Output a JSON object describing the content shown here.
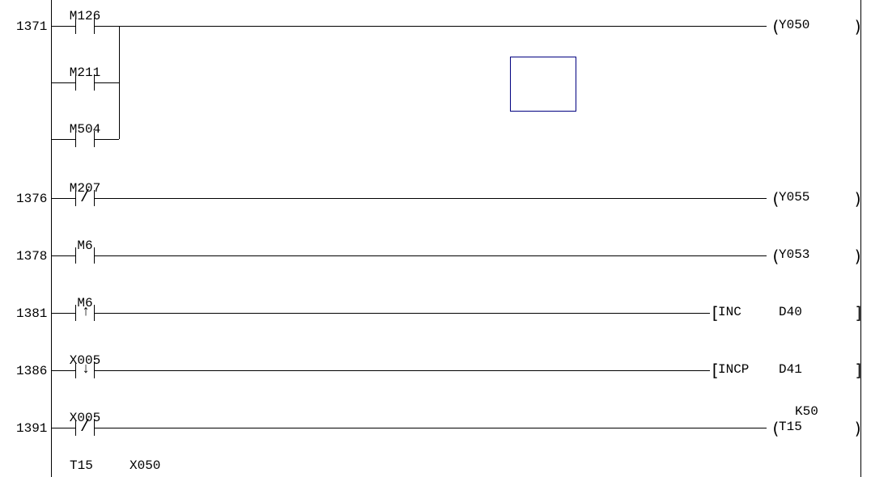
{
  "steps": {
    "s1371": "1371",
    "s1376": "1376",
    "s1378": "1378",
    "s1381": "1381",
    "s1386": "1386",
    "s1391": "1391"
  },
  "contacts": {
    "m126": "M126",
    "m211": "M211",
    "m504": "M504",
    "m207": "M207",
    "m6a": "M6",
    "m6b": "M6",
    "x005a": "X005",
    "x005b": "X005"
  },
  "coils": {
    "y050": "Y050",
    "y055": "Y055",
    "y053": "Y053",
    "t15": "T15"
  },
  "func": {
    "inc": {
      "op": "INC",
      "arg": "D40"
    },
    "incp": {
      "op": "INCP",
      "arg": "D41"
    }
  },
  "timer": {
    "preset": "K50"
  },
  "bottom": {
    "t15": "T15",
    "x050": "X050"
  },
  "paren": {
    "l": "(",
    "r": ")"
  },
  "brack": {
    "l": "[",
    "r": "]"
  }
}
